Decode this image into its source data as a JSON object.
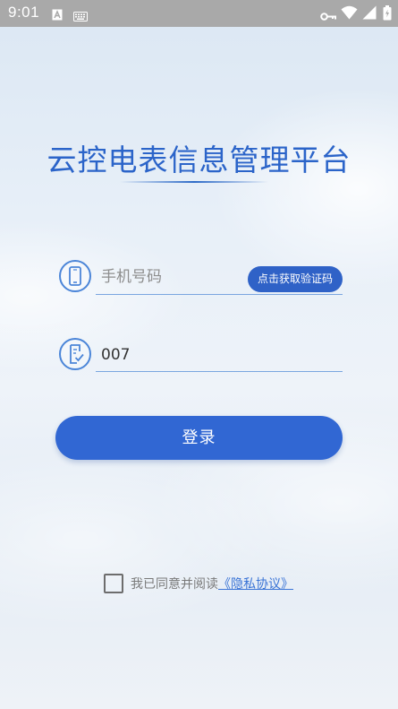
{
  "status_bar": {
    "time": "9:01",
    "icons": [
      "a-icon",
      "keyboard-icon",
      "vpn-key-icon",
      "wifi-icon",
      "signal-icon",
      "battery-icon"
    ]
  },
  "app": {
    "title": "云控电表信息管理平台"
  },
  "login_form": {
    "phone_placeholder": "手机号码",
    "phone_value": "",
    "get_code_label": "点击获取验证码",
    "code_value": "007",
    "login_label": "登录"
  },
  "agreement": {
    "checked": false,
    "text": "我已同意并阅读",
    "link_text": "《隐私协议》"
  },
  "colors": {
    "accent": "#2f62c7",
    "title": "#2b64c9",
    "status_bar": "#a9a9a9"
  }
}
